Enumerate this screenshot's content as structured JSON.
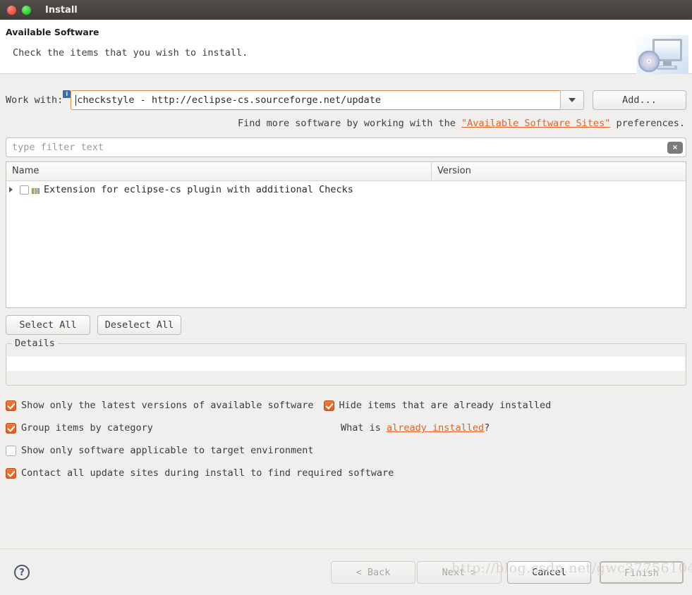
{
  "window": {
    "title": "Install",
    "controls": {
      "close": "close-button",
      "maximize": "maximize-button"
    }
  },
  "banner": {
    "title": "Available Software",
    "subtitle": "Check the items that you wish to install.",
    "icon": "install-computer-disc-icon"
  },
  "work_with": {
    "label": "Work with:",
    "info_badge": "i",
    "value": "checkstyle - http://eclipse-cs.sourceforge.net/update",
    "add_button": "Add...",
    "dropdown_icon": "chevron-down-icon"
  },
  "hint": {
    "prefix": "Find more software by working with the ",
    "link": "\"Available Software Sites\"",
    "suffix": " preferences."
  },
  "filter": {
    "placeholder": "type filter text",
    "value": "",
    "clear_icon": "×"
  },
  "table": {
    "columns": [
      "Name",
      "Version"
    ],
    "rows": [
      {
        "expander": "triangle-right-icon",
        "checked": false,
        "icon": "category-icon",
        "name": "Extension for eclipse-cs plugin with additional Checks",
        "version": ""
      }
    ]
  },
  "selection_buttons": {
    "select_all": "Select All",
    "deselect_all": "Deselect All"
  },
  "details": {
    "legend": "Details",
    "content": ""
  },
  "options": [
    {
      "label": "Show only the latest versions of available software",
      "checked": true
    },
    {
      "label": "Hide items that are already installed",
      "checked": true
    },
    {
      "label": "Group items by category",
      "checked": true
    },
    {
      "label": "Show only software applicable to target environment",
      "checked": false
    },
    {
      "label": "Contact all update sites during install to find required software",
      "checked": true
    }
  ],
  "already_installed": {
    "prefix": "What is ",
    "link": "already installed",
    "suffix": "?"
  },
  "footer": {
    "help_icon": "?",
    "back": "< Back",
    "next": "Next >",
    "cancel": "Cancel",
    "finish": "Finish"
  },
  "watermark": "http://blog.csdn.net/gwc37756104",
  "colors": {
    "accent_orange": "#e0622b",
    "checkbox_on": "#d9622c",
    "focus_border": "#e08a4a",
    "titlebar": "#413e3b",
    "body_bg": "#f0efee"
  }
}
